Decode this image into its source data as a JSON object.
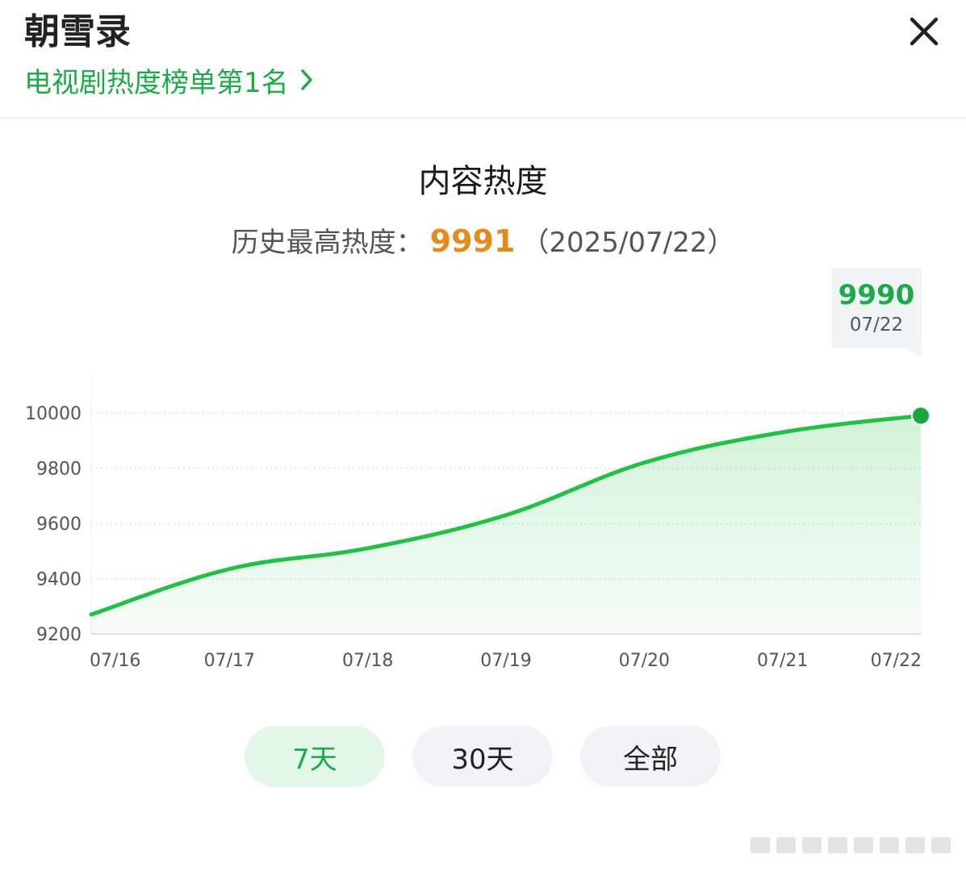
{
  "header": {
    "title": "朝雪录",
    "rank_text": "电视剧热度榜单第1名",
    "close_icon": "close-icon",
    "chevron_icon": "chevron-right-icon"
  },
  "heat": {
    "section_title": "内容热度",
    "record_label": "历史最高热度：",
    "record_value": "9991",
    "record_date": "（2025/07/22）"
  },
  "tooltip": {
    "value": "9990",
    "date": "07/22"
  },
  "colors": {
    "accent_green": "#1faa4a",
    "line_green": "#22c146",
    "record_orange": "#e48b1b"
  },
  "chart_data": {
    "type": "area",
    "title": "内容热度",
    "x": [
      "07/16",
      "07/17",
      "07/18",
      "07/19",
      "07/20",
      "07/21",
      "07/22"
    ],
    "series": [
      {
        "values": [
          9270,
          9435,
          9510,
          9630,
          9820,
          9930,
          9990
        ]
      }
    ],
    "yticks": [
      "9200",
      "9400",
      "9600",
      "9800",
      "10000"
    ],
    "ylim": [
      9200,
      10000
    ],
    "grid": true,
    "legend": "none",
    "highlight_index": 6
  },
  "tabs": [
    {
      "label": "7天",
      "active": true
    },
    {
      "label": "30天",
      "active": false
    },
    {
      "label": "全部",
      "active": false
    }
  ]
}
